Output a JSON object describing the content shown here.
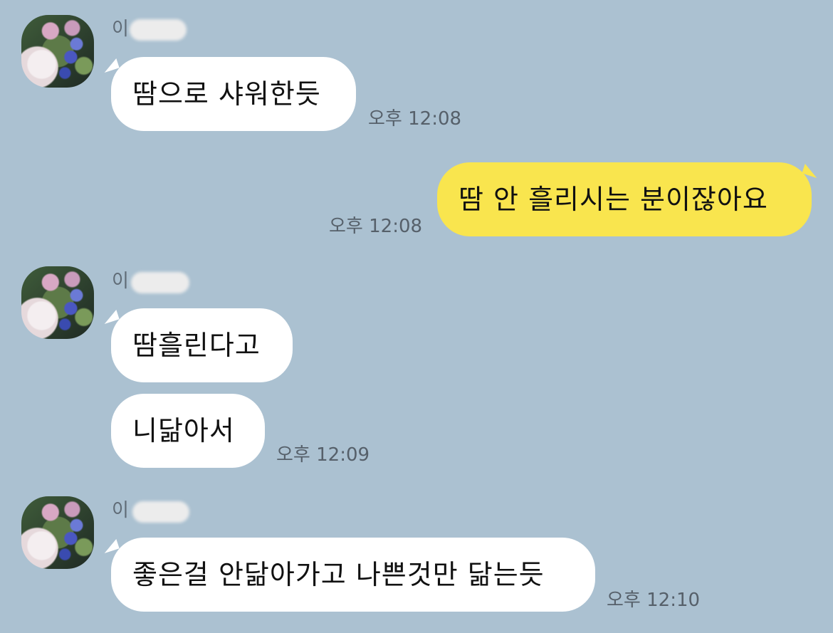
{
  "messages": [
    {
      "sender_visible": "이",
      "text": "땀으로 샤워한듯",
      "time": "오후 12:08"
    },
    {
      "text": "땀 안 흘리시는 분이잖아요",
      "time": "오후 12:08"
    },
    {
      "sender_visible": "이",
      "text": "땀흘린다고"
    },
    {
      "text": "니닮아서",
      "time": "오후 12:09"
    },
    {
      "sender_visible": "이",
      "text": "좋은걸 안닮아가고 나쁜것만 닮는듯",
      "time": "오후 12:10"
    }
  ],
  "colors": {
    "background": "#abc1d1",
    "incoming_bubble": "#ffffff",
    "outgoing_bubble": "#f9e54e"
  },
  "icons": {
    "avatar": "profile-photo-flowers"
  }
}
